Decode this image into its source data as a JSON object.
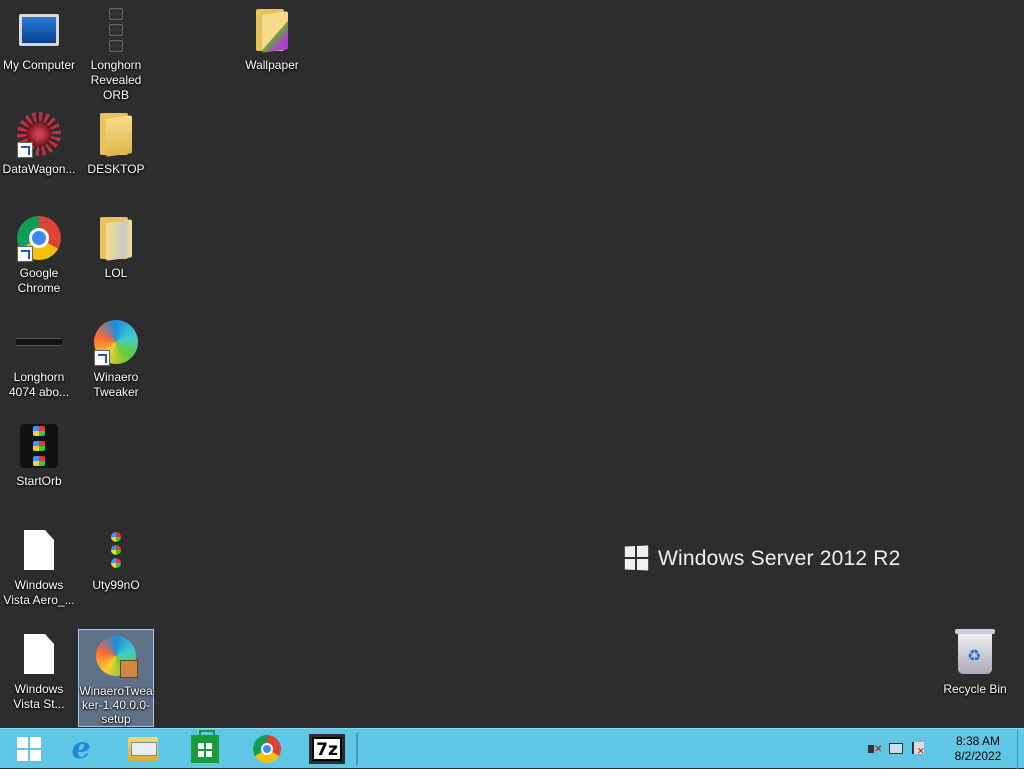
{
  "desktop": {
    "icons": [
      {
        "label": "My Computer",
        "icon": "computer-icon"
      },
      {
        "label": "Longhorn Revealed ORB",
        "icon": "orb-icon"
      },
      {
        "label": "Wallpaper",
        "icon": "folder-icon"
      },
      {
        "label": "DataWagon...",
        "icon": "datawagon-icon"
      },
      {
        "label": "DESKTOP",
        "icon": "folder-icon"
      },
      {
        "label": "Google Chrome",
        "icon": "chrome-icon"
      },
      {
        "label": "LOL",
        "icon": "folder-icon"
      },
      {
        "label": "Longhorn 4074 abo...",
        "icon": "image-icon"
      },
      {
        "label": "Winaero Tweaker",
        "icon": "winaero-icon"
      },
      {
        "label": "StartOrb",
        "icon": "orb-icon"
      },
      {
        "label": "Windows Vista Aero_...",
        "icon": "document-icon"
      },
      {
        "label": "Uty99nO",
        "icon": "orb-icon"
      },
      {
        "label": "Windows Vista St...",
        "icon": "document-icon"
      },
      {
        "label": "WinaeroTweaker-1.40.0.0-setup",
        "icon": "installer-icon"
      },
      {
        "label": "Recycle Bin",
        "icon": "recycle-bin-icon"
      }
    ],
    "watermark": "Windows Server 2012 R2"
  },
  "taskbar": {
    "color": "#5fc6e6",
    "pinned": [
      "start-icon",
      "internet-explorer-icon",
      "file-explorer-icon",
      "store-icon",
      "chrome-icon",
      "7zip-icon"
    ],
    "sevenzip_label": "7z",
    "clock": {
      "time": "8:38 AM",
      "date": "8/2/2022"
    }
  }
}
